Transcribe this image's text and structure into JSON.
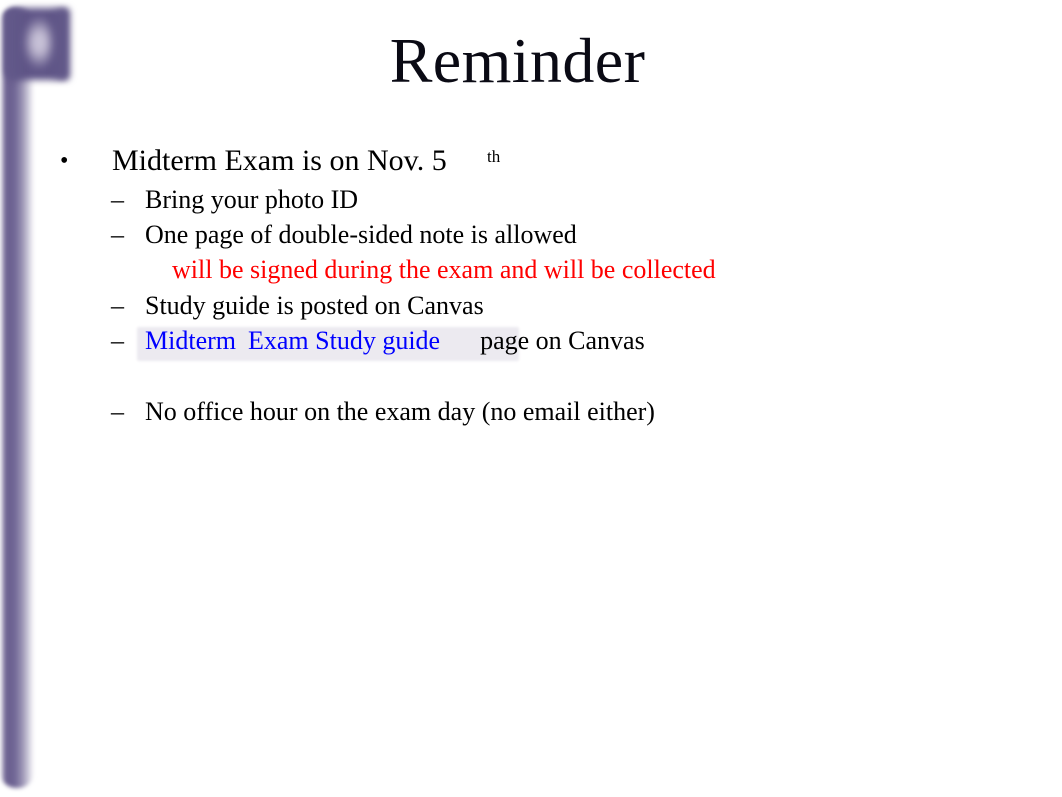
{
  "slide": {
    "title": "Reminder",
    "background_color": "#ffffff",
    "decoration": {
      "name": "flag-pole-decoration",
      "pole_color": "#6a5f8f",
      "banner_center_color": "#c3bdd4",
      "banner_edge_color": "#635a8a"
    },
    "colors": {
      "title": "#0a0a14",
      "body_text": "#000000",
      "emphasis_red": "#ff0000",
      "hyperlink_blue": "#0000ff",
      "link_highlight": "#eceaf0"
    },
    "bullets": {
      "level1_marker": "•",
      "level2_marker": "–"
    },
    "lines": [
      {
        "level": 1,
        "text": "Midterm Exam is on Nov. 5",
        "superscript": "th"
      },
      {
        "level": 2,
        "text": "Bring your photo ID"
      },
      {
        "level": 2,
        "text": "One page of double-sided note is allowed"
      },
      {
        "level": "continuation",
        "text": "will be signed during the exam and will be collected",
        "color": "#ff0000"
      },
      {
        "level": 2,
        "text": "Study guide is posted on Canvas"
      },
      {
        "level": 2,
        "link_part_1": "Midterm",
        "link_part_2": "Exam Study guide",
        "trailing_text": "page on Canvas"
      },
      {
        "level": 2,
        "text": "No office hour on the exam day (no email either)"
      }
    ]
  }
}
